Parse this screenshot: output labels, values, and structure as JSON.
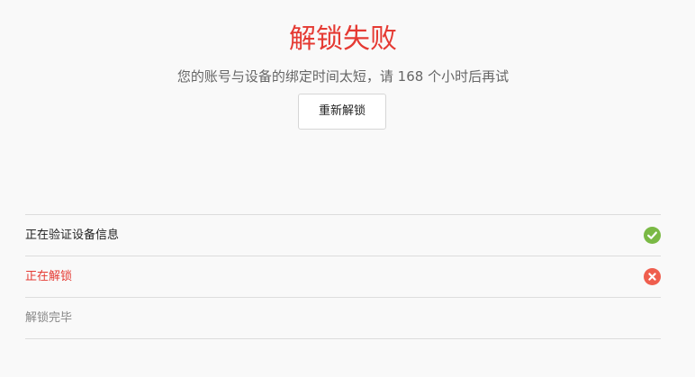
{
  "result": {
    "title": "解锁失败",
    "message": "您的账号与设备的绑定时间太短，请 168 个小时后再试"
  },
  "actions": {
    "retry_label": "重新解锁"
  },
  "steps": [
    {
      "label": "正在验证设备信息",
      "status": "done",
      "icon": "check-circle-icon",
      "color": "#7ab945"
    },
    {
      "label": "正在解锁",
      "status": "failed",
      "icon": "x-circle-icon",
      "color": "#ef5e4e"
    },
    {
      "label": "解锁完毕",
      "status": "pending"
    }
  ],
  "colors": {
    "error": "#e53a33",
    "success": "#7ab945",
    "fail_icon": "#ef5e4e",
    "muted_text": "#888888",
    "divider": "#dddddd",
    "background": "#f9f9f9"
  }
}
